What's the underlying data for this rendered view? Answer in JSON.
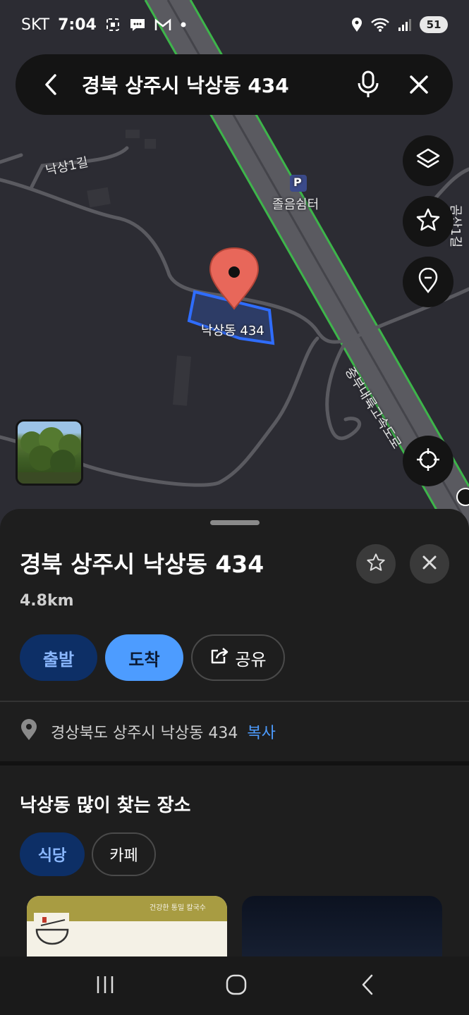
{
  "status_bar": {
    "carrier": "SKT",
    "time": "7:04",
    "battery": "51"
  },
  "search": {
    "query": "경북 상주시 낙상동 434"
  },
  "map": {
    "labels": {
      "road_nakssang1gil": "낙상1길",
      "poi_rest_area": "졸음쉼터",
      "poi_parking_symbol": "P",
      "pin_label": "낙상동 434",
      "highway": "중부내륙고속도로",
      "road_right": "곰산1길"
    }
  },
  "sheet": {
    "title": "경북 상주시 낙상동 434",
    "distance": "4.8km",
    "buttons": {
      "depart": "출발",
      "arrive": "도착",
      "share": "공유"
    },
    "address": "경상북도 상주시 낙상동 434",
    "copy_label": "복사",
    "section_title": "낙상동 많이 찾는 장소",
    "chips": {
      "food": "식당",
      "cafe": "카페"
    },
    "card_tagline": "건강한 통밀 칼국수"
  },
  "colors": {
    "accent": "#4d9cff",
    "pin": "#e8675a",
    "highway_edge": "#3db54a",
    "parcel_outline": "#2f6dff"
  }
}
